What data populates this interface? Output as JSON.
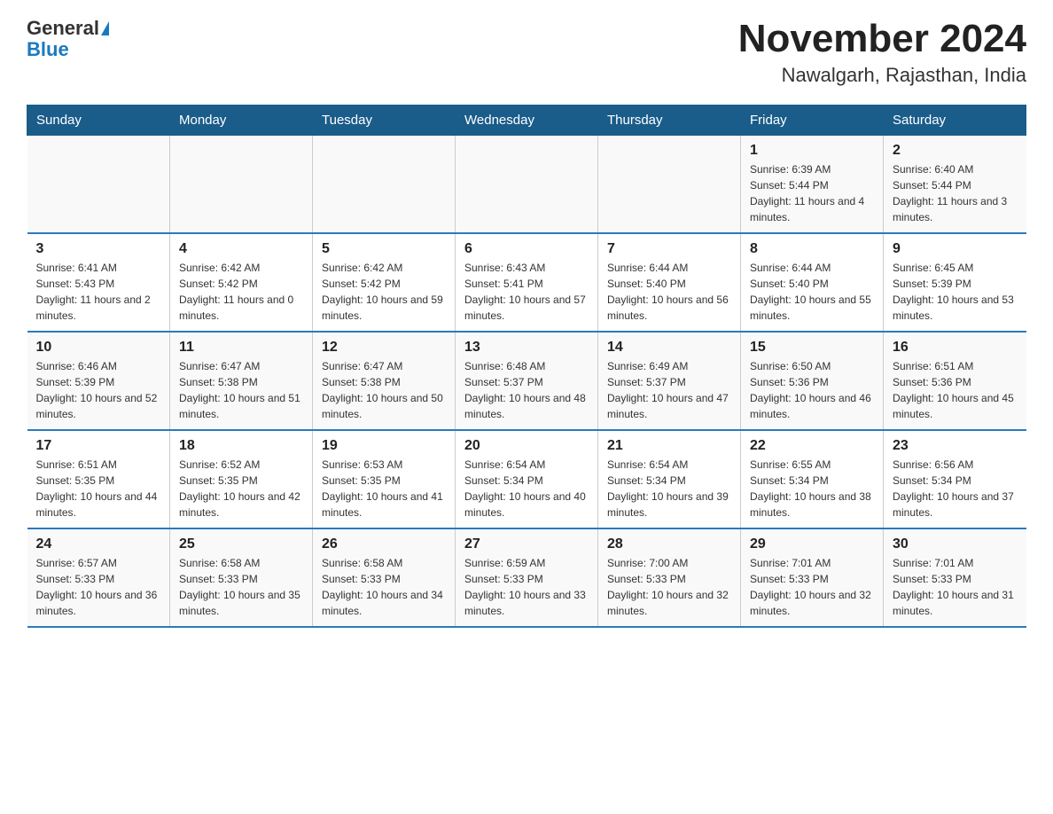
{
  "logo": {
    "general": "General",
    "blue": "Blue"
  },
  "title": "November 2024",
  "subtitle": "Nawalgarh, Rajasthan, India",
  "days_of_week": [
    "Sunday",
    "Monday",
    "Tuesday",
    "Wednesday",
    "Thursday",
    "Friday",
    "Saturday"
  ],
  "weeks": [
    [
      {
        "day": "",
        "info": ""
      },
      {
        "day": "",
        "info": ""
      },
      {
        "day": "",
        "info": ""
      },
      {
        "day": "",
        "info": ""
      },
      {
        "day": "",
        "info": ""
      },
      {
        "day": "1",
        "info": "Sunrise: 6:39 AM\nSunset: 5:44 PM\nDaylight: 11 hours and 4 minutes."
      },
      {
        "day": "2",
        "info": "Sunrise: 6:40 AM\nSunset: 5:44 PM\nDaylight: 11 hours and 3 minutes."
      }
    ],
    [
      {
        "day": "3",
        "info": "Sunrise: 6:41 AM\nSunset: 5:43 PM\nDaylight: 11 hours and 2 minutes."
      },
      {
        "day": "4",
        "info": "Sunrise: 6:42 AM\nSunset: 5:42 PM\nDaylight: 11 hours and 0 minutes."
      },
      {
        "day": "5",
        "info": "Sunrise: 6:42 AM\nSunset: 5:42 PM\nDaylight: 10 hours and 59 minutes."
      },
      {
        "day": "6",
        "info": "Sunrise: 6:43 AM\nSunset: 5:41 PM\nDaylight: 10 hours and 57 minutes."
      },
      {
        "day": "7",
        "info": "Sunrise: 6:44 AM\nSunset: 5:40 PM\nDaylight: 10 hours and 56 minutes."
      },
      {
        "day": "8",
        "info": "Sunrise: 6:44 AM\nSunset: 5:40 PM\nDaylight: 10 hours and 55 minutes."
      },
      {
        "day": "9",
        "info": "Sunrise: 6:45 AM\nSunset: 5:39 PM\nDaylight: 10 hours and 53 minutes."
      }
    ],
    [
      {
        "day": "10",
        "info": "Sunrise: 6:46 AM\nSunset: 5:39 PM\nDaylight: 10 hours and 52 minutes."
      },
      {
        "day": "11",
        "info": "Sunrise: 6:47 AM\nSunset: 5:38 PM\nDaylight: 10 hours and 51 minutes."
      },
      {
        "day": "12",
        "info": "Sunrise: 6:47 AM\nSunset: 5:38 PM\nDaylight: 10 hours and 50 minutes."
      },
      {
        "day": "13",
        "info": "Sunrise: 6:48 AM\nSunset: 5:37 PM\nDaylight: 10 hours and 48 minutes."
      },
      {
        "day": "14",
        "info": "Sunrise: 6:49 AM\nSunset: 5:37 PM\nDaylight: 10 hours and 47 minutes."
      },
      {
        "day": "15",
        "info": "Sunrise: 6:50 AM\nSunset: 5:36 PM\nDaylight: 10 hours and 46 minutes."
      },
      {
        "day": "16",
        "info": "Sunrise: 6:51 AM\nSunset: 5:36 PM\nDaylight: 10 hours and 45 minutes."
      }
    ],
    [
      {
        "day": "17",
        "info": "Sunrise: 6:51 AM\nSunset: 5:35 PM\nDaylight: 10 hours and 44 minutes."
      },
      {
        "day": "18",
        "info": "Sunrise: 6:52 AM\nSunset: 5:35 PM\nDaylight: 10 hours and 42 minutes."
      },
      {
        "day": "19",
        "info": "Sunrise: 6:53 AM\nSunset: 5:35 PM\nDaylight: 10 hours and 41 minutes."
      },
      {
        "day": "20",
        "info": "Sunrise: 6:54 AM\nSunset: 5:34 PM\nDaylight: 10 hours and 40 minutes."
      },
      {
        "day": "21",
        "info": "Sunrise: 6:54 AM\nSunset: 5:34 PM\nDaylight: 10 hours and 39 minutes."
      },
      {
        "day": "22",
        "info": "Sunrise: 6:55 AM\nSunset: 5:34 PM\nDaylight: 10 hours and 38 minutes."
      },
      {
        "day": "23",
        "info": "Sunrise: 6:56 AM\nSunset: 5:34 PM\nDaylight: 10 hours and 37 minutes."
      }
    ],
    [
      {
        "day": "24",
        "info": "Sunrise: 6:57 AM\nSunset: 5:33 PM\nDaylight: 10 hours and 36 minutes."
      },
      {
        "day": "25",
        "info": "Sunrise: 6:58 AM\nSunset: 5:33 PM\nDaylight: 10 hours and 35 minutes."
      },
      {
        "day": "26",
        "info": "Sunrise: 6:58 AM\nSunset: 5:33 PM\nDaylight: 10 hours and 34 minutes."
      },
      {
        "day": "27",
        "info": "Sunrise: 6:59 AM\nSunset: 5:33 PM\nDaylight: 10 hours and 33 minutes."
      },
      {
        "day": "28",
        "info": "Sunrise: 7:00 AM\nSunset: 5:33 PM\nDaylight: 10 hours and 32 minutes."
      },
      {
        "day": "29",
        "info": "Sunrise: 7:01 AM\nSunset: 5:33 PM\nDaylight: 10 hours and 32 minutes."
      },
      {
        "day": "30",
        "info": "Sunrise: 7:01 AM\nSunset: 5:33 PM\nDaylight: 10 hours and 31 minutes."
      }
    ]
  ]
}
